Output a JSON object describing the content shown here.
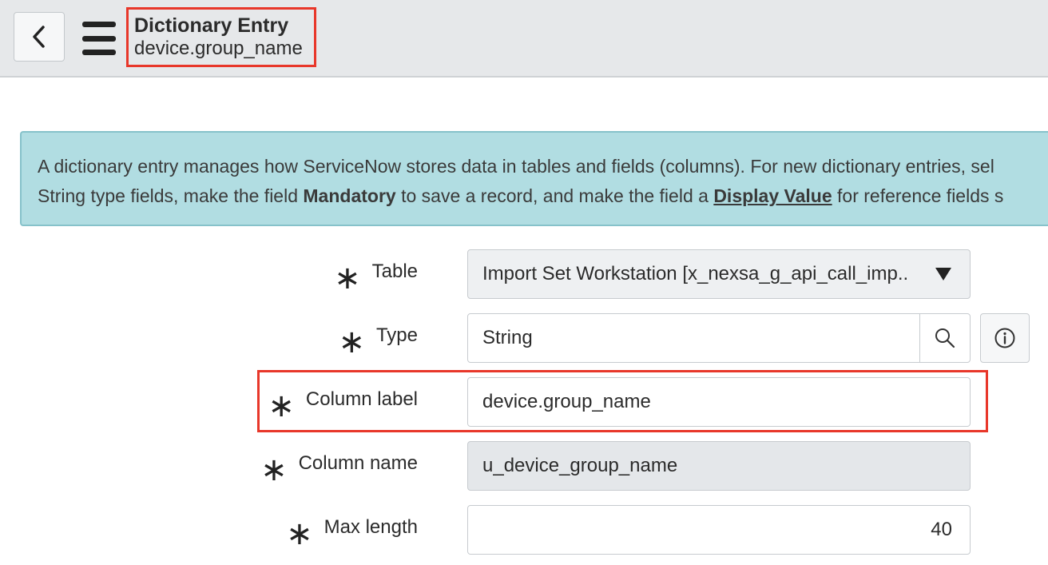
{
  "header": {
    "back_icon": "chevron-left-icon",
    "menu_icon": "hamburger-menu-icon",
    "title": "Dictionary Entry",
    "subtitle": "device.group_name"
  },
  "banner": {
    "line1": "A dictionary entry manages how ServiceNow stores data in tables and fields (columns). For new dictionary entries, sel",
    "line2_prefix": "String type fields, make the field ",
    "line2_bold": "Mandatory",
    "line2_mid": " to save a record, and make the field a ",
    "line2_link": "Display Value",
    "line2_suffix": " for reference fields s"
  },
  "form": {
    "table": {
      "label": "Table",
      "value": "Import Set Workstation [x_nexsa_g_api_call_imp..",
      "icon": "dropdown-arrow-icon"
    },
    "type": {
      "label": "Type",
      "value": "String",
      "search_icon": "search-icon",
      "info_icon": "info-icon"
    },
    "column_label": {
      "label": "Column label",
      "value": "device.group_name"
    },
    "column_name": {
      "label": "Column name",
      "value": "u_device_group_name"
    },
    "max_length": {
      "label": "Max length",
      "value": "40"
    },
    "required_marker": "∗"
  },
  "colors": {
    "header_bg": "#e6e8ea",
    "banner_bg": "#b1dde2",
    "highlight": "#e8372a"
  }
}
